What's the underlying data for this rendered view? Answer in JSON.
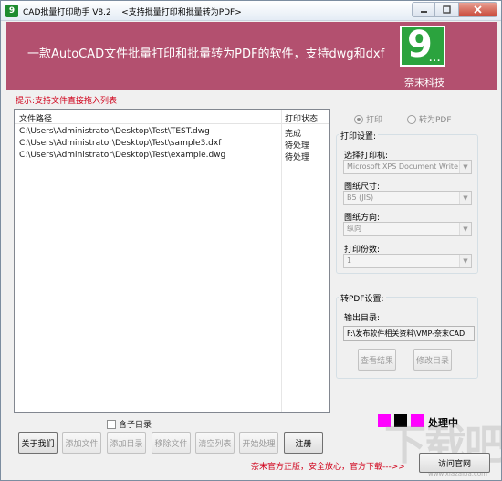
{
  "window": {
    "icon_glyph": "9",
    "title": "CAD批量打印助手 V8.2",
    "subtitle": "<支持批量打印和批量转为PDF>",
    "minimize_icon": "minimize-icon",
    "maximize_icon": "maximize-icon",
    "close_icon": "close-icon"
  },
  "banner": {
    "tagline": "一款AutoCAD文件批量打印和批量转为PDF的软件，支持dwg和dxf",
    "logo_glyph": "9",
    "logo_dots": "...",
    "brand": "奈末科技",
    "background_color": "#b3506f",
    "logo_color": "#2ba33e"
  },
  "hint": "提示:支持文件直接拖入列表",
  "file_list": {
    "columns": [
      "文件路径",
      "打印状态"
    ],
    "rows": [
      {
        "path": "C:\\Users\\Administrator\\Desktop\\Test\\TEST.dwg",
        "status": "完成"
      },
      {
        "path": "C:\\Users\\Administrator\\Desktop\\Test\\sample3.dxf",
        "status": "待处理"
      },
      {
        "path": "C:\\Users\\Administrator\\Desktop\\Test\\example.dwg",
        "status": "待处理"
      }
    ]
  },
  "mode": {
    "print_label": "打印",
    "pdf_label": "转为PDF",
    "selected": "print"
  },
  "print_settings": {
    "title": "打印设置:",
    "printer_label": "选择打印机:",
    "printer_value": "Microsoft XPS Document Write",
    "paper_label": "图纸尺寸:",
    "paper_value": "B5 (JIS)",
    "orientation_label": "图纸方向:",
    "orientation_value": "纵向",
    "copies_label": "打印份数:",
    "copies_value": "1"
  },
  "pdf_settings": {
    "title": "转PDF设置:",
    "output_label": "输出目录:",
    "output_value": "F:\\发布软件相关资料\\VMP-奈末CAD",
    "view_result": "查看结果",
    "change_dir": "修改目录"
  },
  "options": {
    "include_subdir": "含子目录"
  },
  "toolbar": {
    "about": "关于我们",
    "add_file": "添加文件",
    "add_dir": "添加目录",
    "remove_file": "移除文件",
    "clear_list": "清空列表",
    "start": "开始处理",
    "register": "注册"
  },
  "status": {
    "text": "处理中",
    "colors": [
      "#ff00ff",
      "#000000",
      "#ff00ff"
    ]
  },
  "footer": {
    "notice": "奈末官方正版，安全放心，官方下载--->>",
    "visit_site": "访问官网"
  },
  "watermark": {
    "text": "下载吧",
    "sub": "www.xiazaiba.com"
  }
}
